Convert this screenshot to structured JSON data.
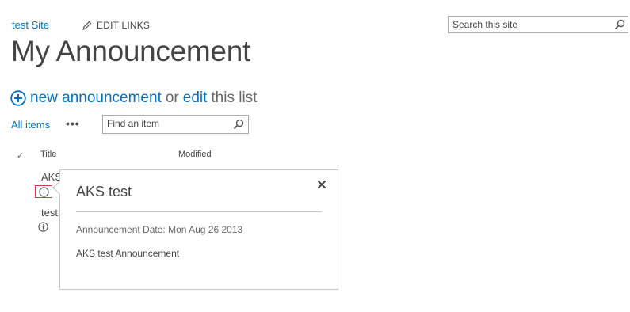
{
  "header": {
    "site_link": "test Site",
    "edit_links_label": "EDIT LINKS",
    "page_title": "My Announcement"
  },
  "site_search": {
    "placeholder": "Search this site",
    "icon": "search-icon"
  },
  "actions": {
    "new_label": "new announcement",
    "or_label": "or",
    "edit_label": "edit",
    "this_list_label": "this list",
    "new_icon": "plus-circle-icon"
  },
  "views": {
    "current_view": "All items",
    "more_label": "•••"
  },
  "find_item": {
    "placeholder": "Find an item",
    "icon": "search-icon"
  },
  "list": {
    "columns": [
      "Title",
      "Modified"
    ],
    "check_glyph": "✓",
    "rows": [
      {
        "title": "AKS",
        "info_icon": "info-icon"
      },
      {
        "title": "test",
        "info_icon": "info-icon"
      }
    ]
  },
  "callout": {
    "title": "AKS test",
    "date_line": "Announcement Date: Mon Aug 26 2013",
    "body": "AKS test Announcement",
    "close_icon": "close-icon"
  },
  "colors": {
    "link": "#0072c6",
    "text": "#444444",
    "border": "#ababab",
    "selected_outline": "#d63a4a"
  }
}
